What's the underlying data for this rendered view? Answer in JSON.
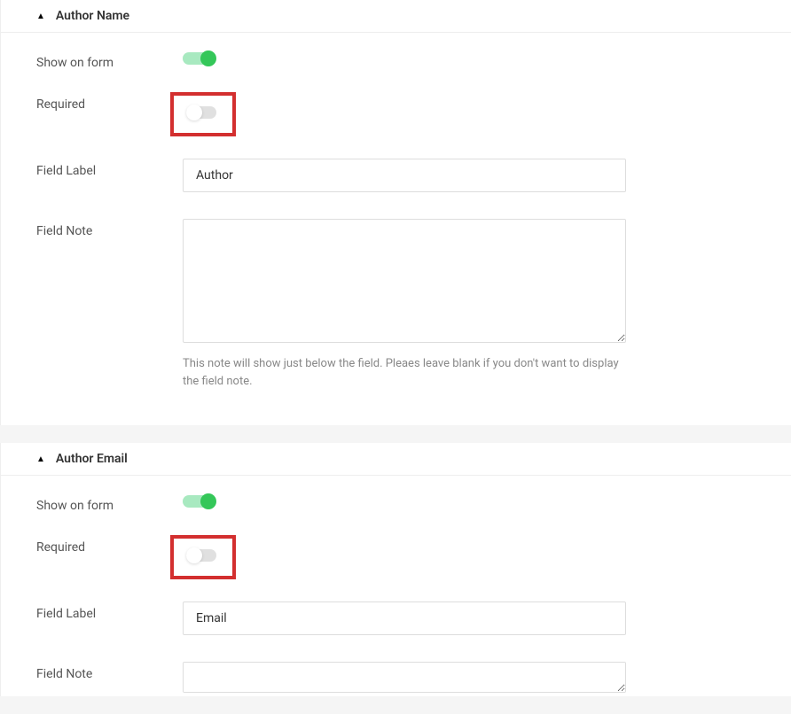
{
  "sections": [
    {
      "title": "Author Name",
      "fields": {
        "showOnForm": {
          "label": "Show on form",
          "value": true,
          "highlighted": false
        },
        "required": {
          "label": "Required",
          "value": false,
          "highlighted": true
        },
        "fieldLabel": {
          "label": "Field Label",
          "value": "Author"
        },
        "fieldNote": {
          "label": "Field Note",
          "value": "",
          "help": "This note will show just below the field. Pleaes leave blank if you don't want to display the field note."
        }
      }
    },
    {
      "title": "Author Email",
      "fields": {
        "showOnForm": {
          "label": "Show on form",
          "value": true,
          "highlighted": false
        },
        "required": {
          "label": "Required",
          "value": false,
          "highlighted": true
        },
        "fieldLabel": {
          "label": "Field Label",
          "value": "Email"
        },
        "fieldNote": {
          "label": "Field Note",
          "value": ""
        }
      }
    }
  ]
}
